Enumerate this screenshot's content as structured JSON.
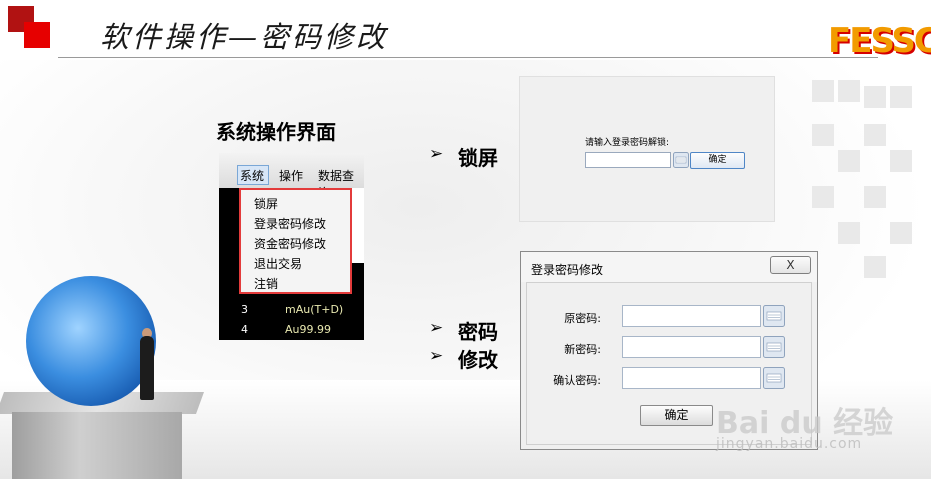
{
  "header": {
    "title": "软件操作—密码修改",
    "brand": "FESSC"
  },
  "left_section": {
    "heading": "系统操作界面",
    "menubar": [
      "系统",
      "操作",
      "数据查询"
    ],
    "dropdown_items": [
      "锁屏",
      "登录密码修改",
      "资金密码修改",
      "退出交易",
      "注销"
    ],
    "grid_rows": [
      {
        "num": "3",
        "name": "mAu(T+D)"
      },
      {
        "num": "4",
        "name": "Au99.99"
      }
    ]
  },
  "bullets": {
    "lock": "锁屏",
    "pwd_line1": "密码",
    "pwd_line2": "修改",
    "arrow": "➢"
  },
  "lock_panel": {
    "prompt": "请输入登录密码解锁:",
    "confirm_label": "确定"
  },
  "password_dialog": {
    "title": "登录密码修改",
    "close_label": "X",
    "fields": [
      {
        "label": "原密码:"
      },
      {
        "label": "新密码:"
      },
      {
        "label": "确认密码:"
      }
    ],
    "confirm_label": "确定"
  },
  "watermark": {
    "logo_text": "Bai du 经验",
    "url": "jingyan.baidu.com"
  },
  "colors": {
    "accent_red": "#e60000",
    "logo_orange": "#f29b00",
    "button_blue_border": "#4f86c6"
  },
  "icons": {
    "keyboard": "keyboard-icon",
    "bullet": "arrow-bullet-icon"
  }
}
